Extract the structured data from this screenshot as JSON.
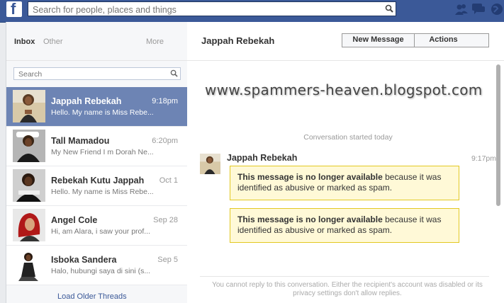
{
  "topbar": {
    "logo": "f",
    "search_placeholder": "Search for people, places and things",
    "brand_color": "#3b5998"
  },
  "inbox": {
    "tabs": [
      "Inbox",
      "Other",
      "More"
    ],
    "search_placeholder": "Search",
    "threads": [
      {
        "name": "Jappah Rebekah",
        "time": "9:18pm",
        "snippet": "Hello. My name is Miss Rebe...",
        "active": true
      },
      {
        "name": "Tall Mamadou",
        "time": "6:20pm",
        "snippet": "My New Friend I m Dorah Ne..."
      },
      {
        "name": "Rebekah Kutu Jappah",
        "time": "Oct 1",
        "snippet": "Hello. My name is Miss Rebe..."
      },
      {
        "name": "Angel Cole",
        "time": "Sep 28",
        "snippet": "Hi, am Alara, i saw your prof..."
      },
      {
        "name": "Isboka Sandera",
        "time": "Sep 5",
        "snippet": "Halo, hubungi saya di sini (s..."
      }
    ],
    "load_older": "Load Older Threads"
  },
  "conversation": {
    "title": "Jappah Rebekah",
    "new_message_label": "New Message",
    "actions_label": "Actions",
    "watermark": "www.spammers-heaven.blogspot.com",
    "started_text": "Conversation started today",
    "sender": "Jappah Rebekah",
    "time": "9:17pm",
    "messages": [
      {
        "bold": "This message is no longer available",
        "rest": " because it was identified as abusive or marked as spam."
      },
      {
        "bold": "This message is no longer available",
        "rest": " because it was identified as abusive or marked as spam."
      }
    ],
    "reply_note": "You cannot reply to this conversation. Either the recipient's account was disabled or its privacy settings don't allow replies."
  }
}
